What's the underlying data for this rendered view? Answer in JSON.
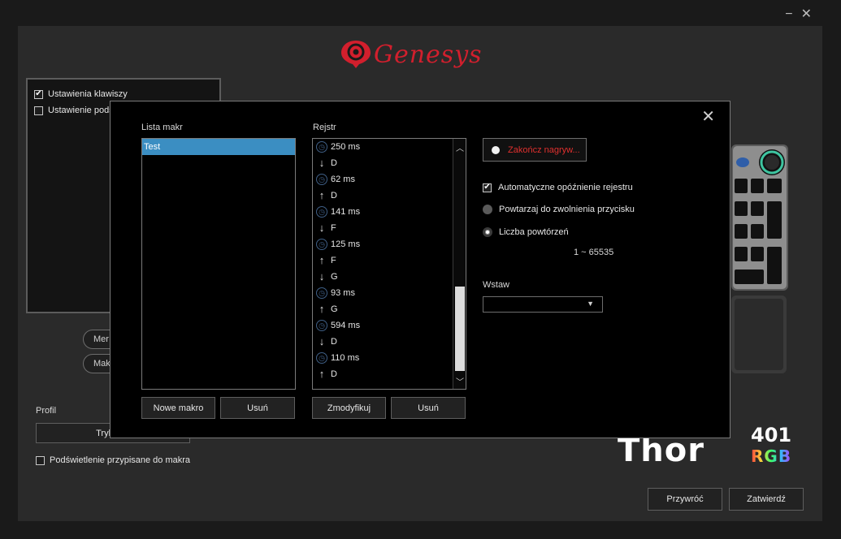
{
  "window": {
    "minimize_glyph": "−",
    "close_glyph": "✕"
  },
  "brand": {
    "logo_text": "Genesys",
    "logo_color": "#d21f2d"
  },
  "left_panel": {
    "items": [
      {
        "label": "Ustawienia klawiszy",
        "checked": true
      },
      {
        "label": "Ustawienie pods",
        "checked": false
      }
    ],
    "pill_buttons": [
      "Mer",
      "Mak"
    ]
  },
  "profile": {
    "label": "Profil",
    "mode_button": "Tryb uży",
    "backlight_checkbox": "Podświetlenie przypisane do makra"
  },
  "footer": {
    "restore": "Przywróć",
    "confirm": "Zatwierdź"
  },
  "product": {
    "name": "Thor",
    "model": "401",
    "rgb": "RGB"
  },
  "dialog": {
    "close_glyph": "✕",
    "macro_list": {
      "label": "Lista makr",
      "items": [
        "Test"
      ],
      "new_button": "Nowe makro",
      "delete_button": "Usuń"
    },
    "register": {
      "label": "Rejstr",
      "rows": [
        {
          "icon": "clock-icon",
          "text": "250 ms"
        },
        {
          "icon": "arrow-down-icon",
          "text": "D"
        },
        {
          "icon": "clock-icon",
          "text": "62 ms"
        },
        {
          "icon": "arrow-up-icon",
          "text": "D"
        },
        {
          "icon": "clock-icon",
          "text": "141 ms"
        },
        {
          "icon": "arrow-down-icon",
          "text": "F"
        },
        {
          "icon": "clock-icon",
          "text": "125 ms"
        },
        {
          "icon": "arrow-up-icon",
          "text": "F"
        },
        {
          "icon": "arrow-down-icon",
          "text": "G"
        },
        {
          "icon": "clock-icon",
          "text": "93 ms"
        },
        {
          "icon": "arrow-up-icon",
          "text": "G"
        },
        {
          "icon": "clock-icon",
          "text": "594 ms"
        },
        {
          "icon": "arrow-down-icon",
          "text": "D"
        },
        {
          "icon": "clock-icon",
          "text": "110 ms"
        },
        {
          "icon": "arrow-up-icon",
          "text": "D"
        }
      ],
      "modify_button": "Zmodyfikuj",
      "delete_button": "Usuń"
    },
    "record_button": "Zakończ nagryw...",
    "record_color": "#e0302e",
    "auto_delay": "Automatyczne opóźnienie rejestru",
    "repeat_until_release": "Powtarzaj do zwolnienia przycisku",
    "repeat_count": "Liczba powtórzeń",
    "repeat_range": "1 ~ 65535",
    "insert_label": "Wstaw",
    "insert_value": ""
  }
}
